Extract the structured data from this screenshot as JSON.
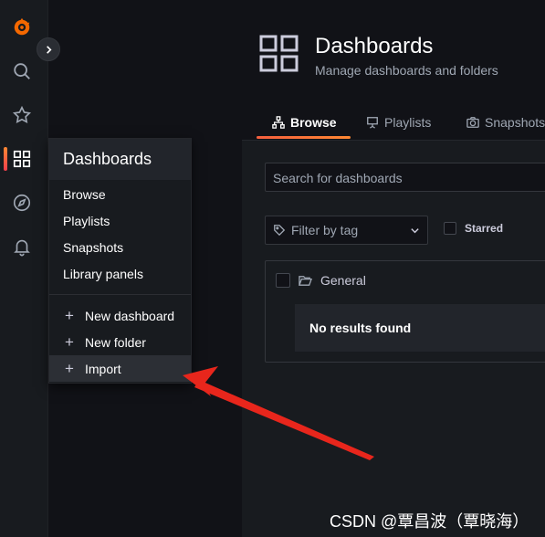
{
  "header": {
    "title": "Dashboards",
    "subtitle": "Manage dashboards and folders"
  },
  "tabs": [
    {
      "label": "Browse",
      "icon": "sitemap-icon",
      "active": true
    },
    {
      "label": "Playlists",
      "icon": "presentation-icon",
      "active": false
    },
    {
      "label": "Snapshots",
      "icon": "camera-icon",
      "active": false
    }
  ],
  "search": {
    "placeholder": "Search for dashboards"
  },
  "filter": {
    "placeholder": "Filter by tag"
  },
  "starred": {
    "label": "Starred",
    "checked": false
  },
  "folder": {
    "name": "General",
    "empty_text": "No results found"
  },
  "menu": {
    "title": "Dashboards",
    "items": [
      "Browse",
      "Playlists",
      "Snapshots",
      "Library panels"
    ],
    "actions": [
      "New dashboard",
      "New folder",
      "Import"
    ]
  },
  "sidebar_icons": [
    "grafana-logo-icon",
    "search-icon",
    "star-icon",
    "dashboards-icon",
    "explore-compass-icon",
    "alerting-bell-icon"
  ],
  "watermark": "CSDN @覃昌波（覃晓海）",
  "colors": {
    "accent": "#ff8833",
    "arrow": "#e8261c",
    "background": "#111217"
  }
}
